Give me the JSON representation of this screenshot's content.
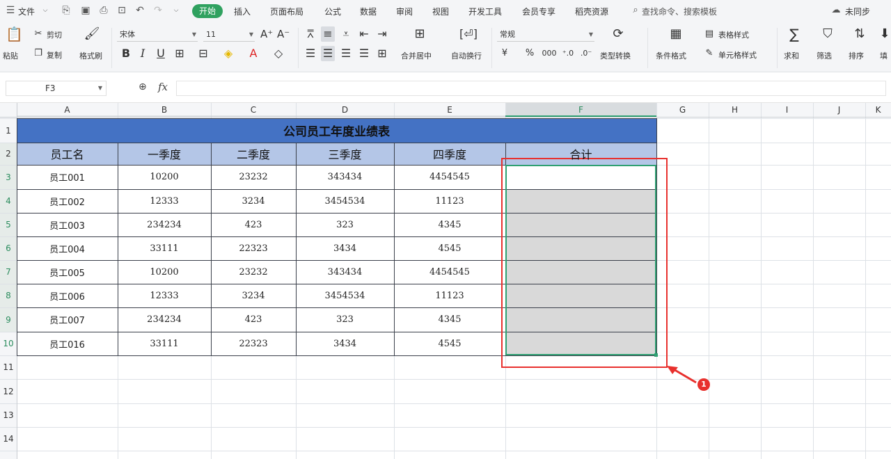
{
  "menubar": {
    "items": [
      "文件",
      "开始",
      "插入",
      "页面布局",
      "公式",
      "数据",
      "审阅",
      "视图",
      "开发工具",
      "会员专享",
      "稻壳资源"
    ],
    "active_tab": "开始",
    "search_placeholder": "查找命令、搜索模板",
    "sync_label": "未同步"
  },
  "ribbon": {
    "paste": "粘贴",
    "cut": "剪切",
    "copy": "复制",
    "format_painter": "格式刷",
    "font_name": "宋体",
    "font_size": "11",
    "merge_center": "合并居中",
    "wrap_text": "自动换行",
    "number_format": "常规",
    "type_convert": "类型转换",
    "conditional_format": "条件格式",
    "table_style": "表格样式",
    "cell_style": "单元格样式",
    "sum": "求和",
    "filter": "筛选",
    "sort": "排序",
    "fill": "填"
  },
  "formula_bar": {
    "name_box": "F3",
    "fx": "fx",
    "formula": ""
  },
  "colors": {
    "title_bg": "#4472c4",
    "header_bg": "#b4c6e7",
    "selection_bg": "#d9d9d9",
    "selection_border": "#2fa072",
    "annotation_red": "#e8302d",
    "accent_green": "#2fa15f"
  },
  "sheet": {
    "column_headers": [
      "A",
      "B",
      "C",
      "D",
      "E",
      "F",
      "G",
      "H",
      "I",
      "J",
      "K"
    ],
    "row_headers": [
      "1",
      "2",
      "3",
      "4",
      "5",
      "6",
      "7",
      "8",
      "9",
      "10",
      "11",
      "12",
      "13",
      "14"
    ],
    "title": "公司员工年度业绩表",
    "headers": [
      "员工名",
      "一季度",
      "二季度",
      "三季度",
      "四季度",
      "合计"
    ],
    "rows": [
      [
        "员工001",
        "10200",
        "23232",
        "343434",
        "4454545",
        ""
      ],
      [
        "员工002",
        "12333",
        "3234",
        "3454534",
        "11123",
        ""
      ],
      [
        "员工003",
        "234234",
        "423",
        "323",
        "4345",
        ""
      ],
      [
        "员工004",
        "33111",
        "22323",
        "3434",
        "4545",
        ""
      ],
      [
        "员工005",
        "10200",
        "23232",
        "343434",
        "4454545",
        ""
      ],
      [
        "员工006",
        "12333",
        "3234",
        "3454534",
        "11123",
        ""
      ],
      [
        "员工007",
        "234234",
        "423",
        "323",
        "4345",
        ""
      ],
      [
        "员工016",
        "33111",
        "22323",
        "3434",
        "4545",
        ""
      ]
    ],
    "selected_range": "F3:F10",
    "active_column": "F"
  },
  "annotation": {
    "badge": "1"
  }
}
